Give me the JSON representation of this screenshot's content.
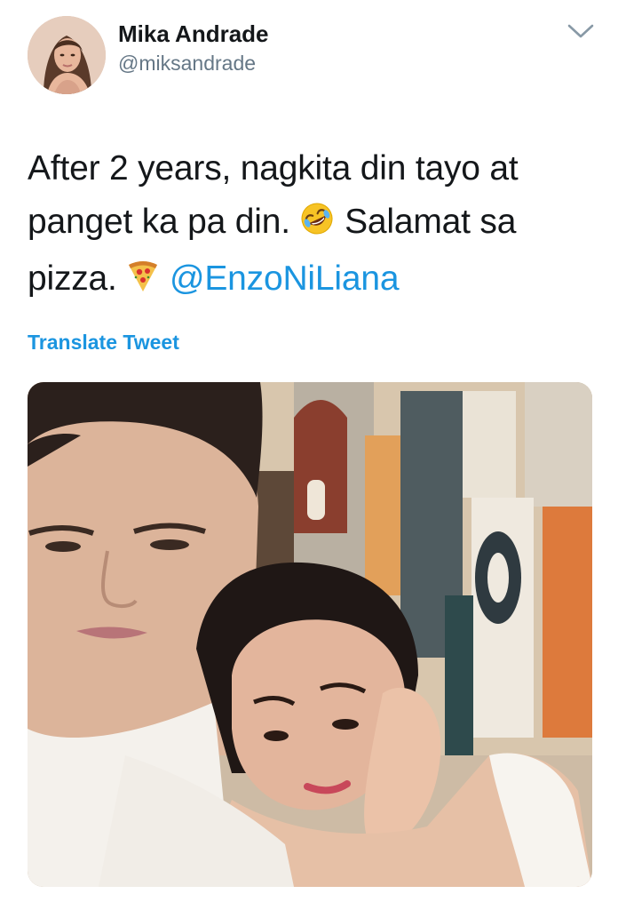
{
  "tweet": {
    "author": {
      "display_name": "Mika Andrade",
      "handle": "@miksandrade",
      "avatar_icon": "profile-photo"
    },
    "text": {
      "segment_1": "After 2 years, nagkita din tayo at panget ka pa din. ",
      "emoji_1": "rolling-on-the-floor-laughing-emoji",
      "segment_2": " Salamat sa pizza. ",
      "emoji_2": "pizza-emoji",
      "mention": "@EnzoNiLiana"
    },
    "translate_label": "Translate Tweet",
    "menu_icon": "chevron-down-icon",
    "media": {
      "type": "photo",
      "description_icon": "photo-of-couple"
    }
  },
  "colors": {
    "text": "#14171a",
    "secondary": "#657786",
    "link": "#1b95e0",
    "background": "#ffffff"
  }
}
